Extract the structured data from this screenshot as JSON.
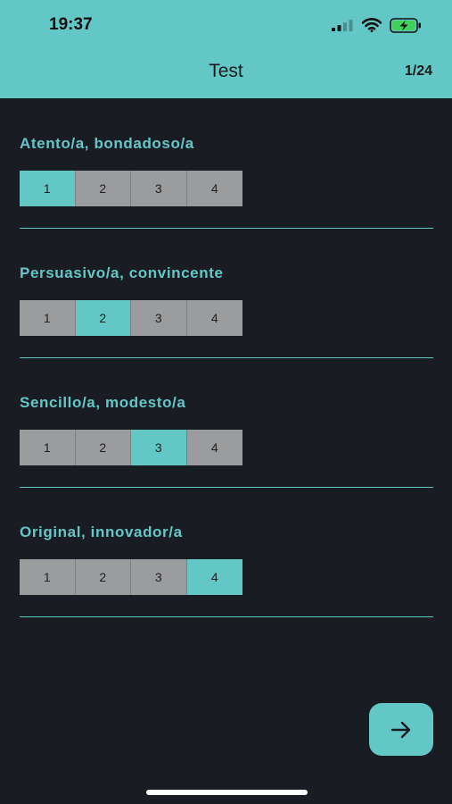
{
  "status_bar": {
    "time": "19:37"
  },
  "header": {
    "title": "Test",
    "counter": "1/24"
  },
  "questions": [
    {
      "label": "Atento/a, bondadoso/a",
      "options": [
        "1",
        "2",
        "3",
        "4"
      ],
      "selected": 1
    },
    {
      "label": "Persuasivo/a, convincente",
      "options": [
        "1",
        "2",
        "3",
        "4"
      ],
      "selected": 2
    },
    {
      "label": "Sencillo/a, modesto/a",
      "options": [
        "1",
        "2",
        "3",
        "4"
      ],
      "selected": 3
    },
    {
      "label": "Original, innovador/a",
      "options": [
        "1",
        "2",
        "3",
        "4"
      ],
      "selected": 4
    }
  ],
  "colors": {
    "accent": "#63c7c6",
    "background": "#1a1c24",
    "unselected": "#9b9c9e"
  },
  "icons": {
    "next": "arrow-right-icon",
    "signal": "signal-icon",
    "wifi": "wifi-icon",
    "battery": "battery-charging-icon"
  }
}
